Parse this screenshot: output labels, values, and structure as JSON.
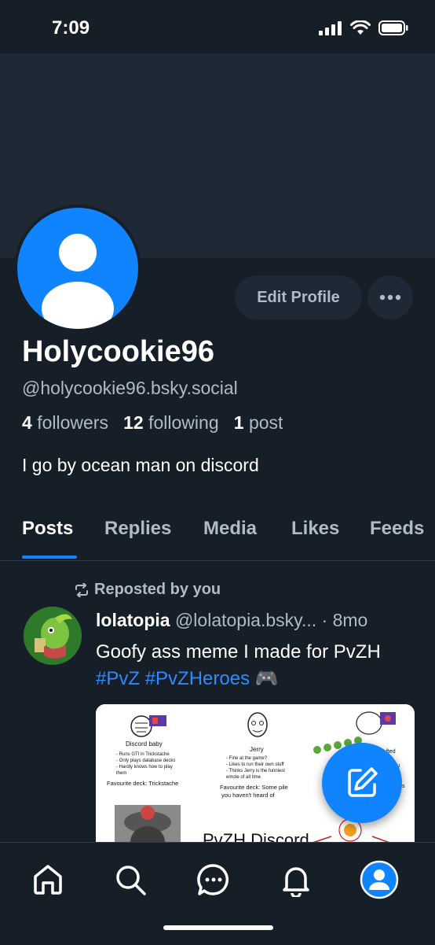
{
  "status_bar": {
    "time": "7:09"
  },
  "profile": {
    "display_name": "Holycookie96",
    "handle": "@holycookie96.bsky.social",
    "followers_count": "4",
    "followers_label": "followers",
    "following_count": "12",
    "following_label": "following",
    "posts_count": "1",
    "posts_label": "post",
    "bio": "I go by ocean man on discord",
    "edit_button": "Edit Profile"
  },
  "tabs": [
    {
      "label": "Posts",
      "active": true
    },
    {
      "label": "Replies"
    },
    {
      "label": "Media"
    },
    {
      "label": "Likes"
    },
    {
      "label": "Feeds"
    }
  ],
  "post": {
    "repost_label": "Reposted by you",
    "author": "lolatopia",
    "author_handle": "@lolatopia.bsky...",
    "separator": "·",
    "time": "8mo",
    "text_prefix": "Goofy ass meme I made for PvZH",
    "hashtag1": "#PvZ",
    "hashtag2": "#PvZHeroes",
    "emoji": "🎮",
    "image": {
      "col1_title": "Discord baby",
      "col1_bullets": [
        "- Runs GTI in Trickstache",
        "- Only plays database decks",
        "- Hardly knows how to play",
        "  them"
      ],
      "col1_fav": "Favourite deck: Trickstache",
      "col2_title": "Jerry",
      "col2_bullets": [
        "- Fine at the game?",
        "- Likes to run their own stuff",
        "- Thinks Jerry is the funniest",
        "  emote of all time"
      ],
      "col2_fav": "Favourite deck: Some pile",
      "col2_fav2": "you haven't heard of",
      "col3_partial": "fted",
      "col3_partial2": "you",
      "col3_partial3": "s",
      "bottom_title": "PvZH Discord"
    }
  },
  "nav": [
    "home-icon",
    "search-icon",
    "chat-icon",
    "bell-icon",
    "profile-icon"
  ],
  "colors": {
    "accent": "#1083fe",
    "background": "#161e27",
    "banner": "#1e2935",
    "muted": "#aebbc9"
  }
}
